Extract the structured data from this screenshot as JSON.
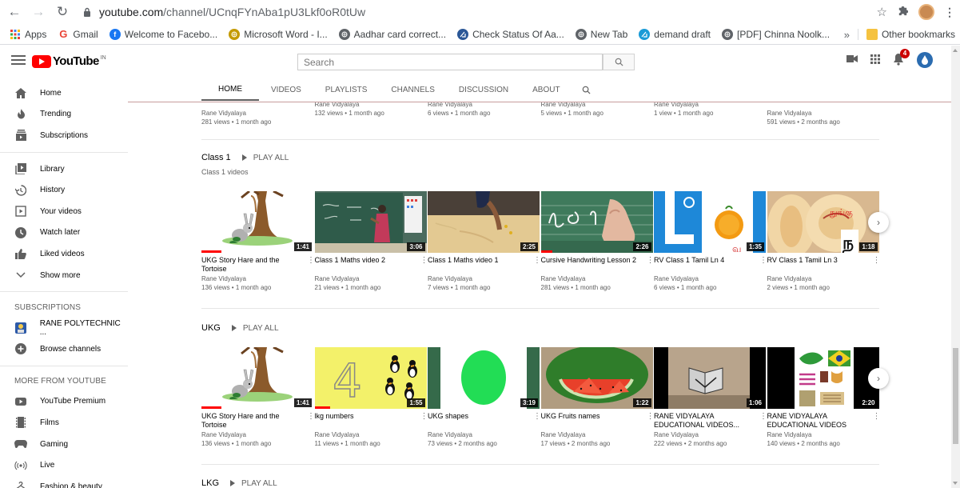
{
  "browser": {
    "url_host": "youtube.com",
    "url_path": "/channel/UCnqFYnAba1pU3Lkf0oR0tUw",
    "bookmarks": [
      {
        "label": "Apps",
        "icon": "apps-grid-icon",
        "color": "#4285f4"
      },
      {
        "label": "Gmail",
        "icon": "google-icon",
        "color": "#ea4335"
      },
      {
        "label": "Welcome to Facebo...",
        "icon": "facebook-icon",
        "color": "#1877f2"
      },
      {
        "label": "Microsoft Word - I...",
        "icon": "globe-icon",
        "color": "#c49a00"
      },
      {
        "label": "Aadhar card correct...",
        "icon": "globe-icon",
        "color": "#5f6368"
      },
      {
        "label": "Check Status Of Aa...",
        "icon": "bookmark-icon",
        "color": "#2b5797"
      },
      {
        "label": "New Tab",
        "icon": "globe-icon",
        "color": "#5f6368"
      },
      {
        "label": "demand draft",
        "icon": "bookmark-icon",
        "color": "#1a9bd7"
      },
      {
        "label": "[PDF] Chinna Noolk...",
        "icon": "globe-icon",
        "color": "#5f6368"
      }
    ],
    "more_label": "»",
    "other_bookmarks": "Other bookmarks"
  },
  "header": {
    "logo_text": "YouTube",
    "logo_country": "IN",
    "search_placeholder": "Search",
    "notification_count": "4"
  },
  "sidebar": {
    "main": [
      {
        "label": "Home",
        "icon": "home-icon"
      },
      {
        "label": "Trending",
        "icon": "flame-icon"
      },
      {
        "label": "Subscriptions",
        "icon": "subscriptions-icon"
      }
    ],
    "library": [
      {
        "label": "Library",
        "icon": "library-icon"
      },
      {
        "label": "History",
        "icon": "history-icon"
      },
      {
        "label": "Your videos",
        "icon": "your-videos-icon"
      },
      {
        "label": "Watch later",
        "icon": "watch-later-icon"
      },
      {
        "label": "Liked videos",
        "icon": "thumbs-up-icon"
      },
      {
        "label": "Show more",
        "icon": "chevron-down-icon"
      }
    ],
    "subscriptions_heading": "SUBSCRIPTIONS",
    "subscriptions": [
      {
        "label": "RANE POLYTECHNIC ...",
        "icon": "channel-avatar-icon"
      },
      {
        "label": "Browse channels",
        "icon": "plus-circle-icon"
      }
    ],
    "more_heading": "MORE FROM YOUTUBE",
    "more": [
      {
        "label": "YouTube Premium",
        "icon": "youtube-premium-icon"
      },
      {
        "label": "Films",
        "icon": "film-icon"
      },
      {
        "label": "Gaming",
        "icon": "gamepad-icon"
      },
      {
        "label": "Live",
        "icon": "live-icon"
      },
      {
        "label": "Fashion & beauty",
        "icon": "hanger-icon"
      }
    ]
  },
  "tabs": [
    {
      "label": "HOME",
      "active": true
    },
    {
      "label": "VIDEOS"
    },
    {
      "label": "PLAYLISTS"
    },
    {
      "label": "CHANNELS"
    },
    {
      "label": "DISCUSSION"
    },
    {
      "label": "ABOUT"
    }
  ],
  "previous_row": [
    {
      "channel": "Rane Vidyalaya",
      "meta": "281 views • 1 month ago"
    },
    {
      "channel": "Rane Vidyalaya",
      "meta": "132 views • 1 month ago"
    },
    {
      "channel": "Rane Vidyalaya",
      "meta": "6 views • 1 month ago"
    },
    {
      "channel": "Rane Vidyalaya",
      "meta": "5 views • 1 month ago"
    },
    {
      "channel": "Rane Vidyalaya",
      "meta": "1 view • 1 month ago"
    },
    {
      "channel": "Rane Vidyalaya",
      "meta": "591 views • 2 months ago"
    }
  ],
  "shelves": [
    {
      "title": "Class 1",
      "play_all": "PLAY ALL",
      "subtitle": "Class 1 videos",
      "videos": [
        {
          "title": "UKG Story Hare and the Tortoise",
          "channel": "Rane Vidyalaya",
          "meta": "136 views • 1 month ago",
          "duration": "1:41",
          "thumb": "hare",
          "progress": 0.18
        },
        {
          "title": "Class 1 Maths video 2",
          "channel": "Rane Vidyalaya",
          "meta": "21 views • 1 month ago",
          "duration": "3:06",
          "thumb": "board"
        },
        {
          "title": "Class 1 Maths video 1",
          "channel": "Rane Vidyalaya",
          "meta": "7 views • 1 month ago",
          "duration": "2:25",
          "thumb": "sand"
        },
        {
          "title": "Cursive Handwriting Lesson 2",
          "channel": "Rane Vidyalaya",
          "meta": "281 views • 1 month ago",
          "duration": "2:26",
          "thumb": "cursive",
          "progress": 0.1
        },
        {
          "title": "RV Class 1 Tamil Ln 4",
          "channel": "Rane Vidyalaya",
          "meta": "6 views • 1 month ago",
          "duration": "1:35",
          "thumb": "tamil4"
        },
        {
          "title": "RV Class 1 Tamil Ln 3",
          "channel": "Rane Vidyalaya",
          "meta": "2 views • 1 month ago",
          "duration": "1:18",
          "thumb": "tamil3"
        }
      ]
    },
    {
      "title": "UKG",
      "play_all": "PLAY ALL",
      "subtitle": "",
      "videos": [
        {
          "title": "UKG Story Hare and the Tortoise",
          "channel": "Rane Vidyalaya",
          "meta": "136 views • 1 month ago",
          "duration": "1:41",
          "thumb": "hare",
          "progress": 0.18
        },
        {
          "title": "lkg numbers",
          "channel": "Rane Vidyalaya",
          "meta": "11 views • 1 month ago",
          "duration": "1:55",
          "thumb": "numbers",
          "progress": 0.14
        },
        {
          "title": "UKG shapes",
          "channel": "Rane Vidyalaya",
          "meta": "73 views • 2 months ago",
          "duration": "3:19",
          "thumb": "shapes"
        },
        {
          "title": "UKG Fruits names",
          "channel": "Rane Vidyalaya",
          "meta": "17 views • 2 months ago",
          "duration": "1:22",
          "thumb": "fruits"
        },
        {
          "title": "RANE VIDYALAYA EDUCATIONAL VIDEOS...",
          "channel": "Rane Vidyalaya",
          "meta": "222 views • 2 months ago",
          "duration": "1:06",
          "thumb": "dark"
        },
        {
          "title": "RANE VIDYALAYA EDUCATIONAL VIDEOS",
          "channel": "Rane Vidyalaya",
          "meta": "140 views • 2 months ago",
          "duration": "2:20",
          "thumb": "collage"
        }
      ]
    },
    {
      "title": "LKG",
      "play_all": "PLAY ALL",
      "subtitle": "",
      "videos": []
    }
  ]
}
